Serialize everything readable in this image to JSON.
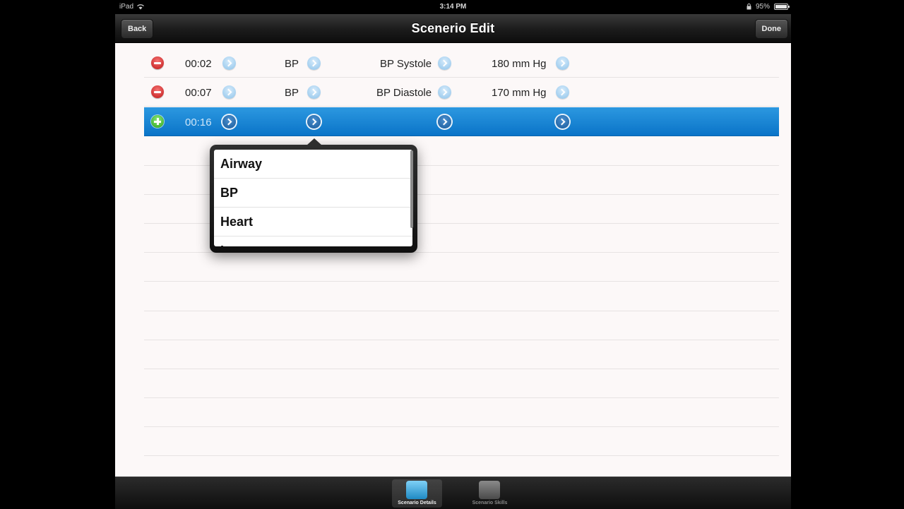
{
  "status_bar": {
    "device": "iPad",
    "time": "3:14 PM",
    "battery": "95%"
  },
  "navbar": {
    "back_label": "Back",
    "title": "Scenerio Edit",
    "done_label": "Done"
  },
  "rows": [
    {
      "time": "00:02",
      "category": "BP",
      "parameter": "BP Systole",
      "value": "180 mm Hg",
      "action": "delete"
    },
    {
      "time": "00:07",
      "category": "BP",
      "parameter": "BP Diastole",
      "value": "170 mm Hg",
      "action": "delete"
    },
    {
      "time": "00:16",
      "category": "",
      "parameter": "",
      "value": "",
      "action": "add",
      "selected": true
    }
  ],
  "popover": {
    "items": [
      "Airway",
      "BP",
      "Heart",
      "L"
    ]
  },
  "tabs": [
    {
      "label": "Scenario Details",
      "icon": "scenario-details-icon",
      "active": true
    },
    {
      "label": "Scenario Skills",
      "icon": "scenario-skills-icon",
      "active": false
    }
  ],
  "colors": {
    "selected_row": "#0a74c8",
    "delete": "#c01818",
    "add": "#2ba318"
  }
}
